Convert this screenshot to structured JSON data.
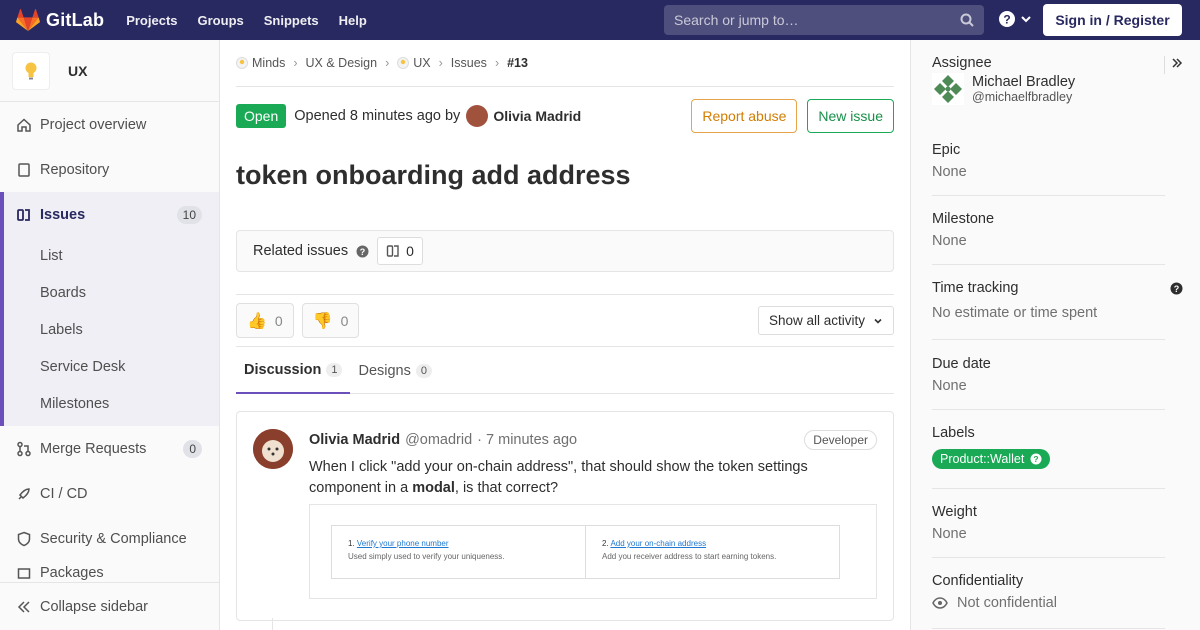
{
  "navbar": {
    "brand": "GitLab",
    "links": [
      "Projects",
      "Groups",
      "Snippets",
      "Help"
    ],
    "search_placeholder": "Search or jump to…",
    "signin_label": "Sign in / Register"
  },
  "sidebar": {
    "project_name": "UX",
    "items": [
      {
        "label": "Project overview",
        "icon": "home-icon"
      },
      {
        "label": "Repository",
        "icon": "doc-icon"
      },
      {
        "label": "Issues",
        "icon": "issues-icon",
        "count": "10"
      },
      {
        "label": "Merge Requests",
        "icon": "merge-icon",
        "count": "0"
      },
      {
        "label": "CI / CD",
        "icon": "rocket-icon"
      },
      {
        "label": "Security & Compliance",
        "icon": "shield-icon"
      }
    ],
    "issue_sub": [
      "List",
      "Boards",
      "Labels",
      "Service Desk",
      "Milestones"
    ],
    "partial_item": "Packages",
    "collapse_label": "Collapse sidebar"
  },
  "breadcrumb": [
    "Minds",
    "UX & Design",
    "UX",
    "Issues",
    "#13"
  ],
  "issue": {
    "status": "Open",
    "opened_text": "Opened 8 minutes ago by",
    "author": "Olivia Madrid",
    "report_abuse": "Report abuse",
    "new_issue": "New issue",
    "title": "token onboarding add address",
    "related_label": "Related issues",
    "related_count": "0",
    "thumbs_up": "0",
    "thumbs_down": "0",
    "activity_filter": "Show all activity",
    "tabs": [
      {
        "label": "Discussion",
        "count": "1"
      },
      {
        "label": "Designs",
        "count": "0"
      }
    ]
  },
  "note": {
    "author": "Olivia Madrid",
    "handle": "@omadrid",
    "time": "· 7 minutes ago",
    "role": "Developer",
    "body_pre": "When I click \"add your on-chain address\", that should show the token settings component in a ",
    "body_bold": "modal",
    "body_post": ", is that correct?",
    "screenshot": {
      "step1_num": "1.",
      "step1_link": "Verify your phone number",
      "step1_desc": "Used simply used to verify your uniqueness.",
      "step2_num": "2.",
      "step2_link": "Add your on-chain address",
      "step2_desc": "Add you receiver address to start earning tokens."
    }
  },
  "right_sidebar": {
    "assignee_title": "Assignee",
    "assignee_name": "Michael Bradley",
    "assignee_handle": "@michaelfbradley",
    "epic_title": "Epic",
    "epic_value": "None",
    "milestone_title": "Milestone",
    "milestone_value": "None",
    "time_title": "Time tracking",
    "time_value": "No estimate or time spent",
    "due_title": "Due date",
    "due_value": "None",
    "labels_title": "Labels",
    "label_value": "Product::Wallet",
    "weight_title": "Weight",
    "weight_value": "None",
    "conf_title": "Confidentiality",
    "conf_value": "Not confidential"
  },
  "colors": {
    "navbar": "#292961",
    "accent": "#6b4fbb",
    "success": "#1aaa55",
    "warning": "#e7a44b"
  }
}
